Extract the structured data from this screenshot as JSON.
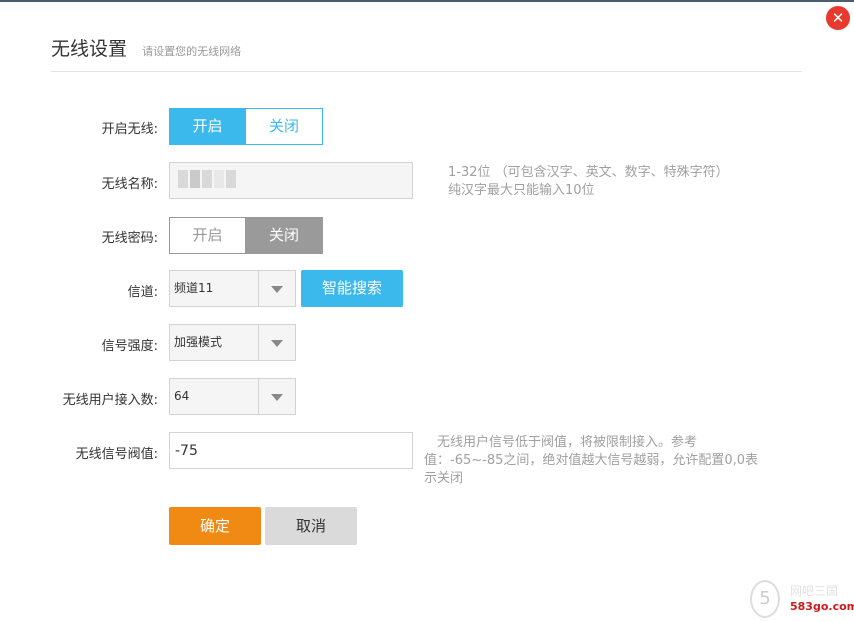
{
  "dialog": {
    "title": "无线设置",
    "subtitle": "请设置您的无线网络",
    "close_symbol": "✕"
  },
  "wireless_switch": {
    "label": "开启无线:",
    "on_label": "开启",
    "off_label": "关闭",
    "selected": "开启"
  },
  "ssid": {
    "label": "无线名称:",
    "value": "",
    "hint_line1": "1-32位 （可包含汉字、英文、数字、特殊字符）",
    "hint_line2": "纯汉字最大只能输入10位"
  },
  "password_switch": {
    "label": "无线密码:",
    "on_label": "开启",
    "off_label": "关闭",
    "selected": "关闭"
  },
  "channel": {
    "label": "信道:",
    "value": "频道11",
    "search_button": "智能搜索"
  },
  "signal_strength": {
    "label": "信号强度:",
    "value": "加强模式"
  },
  "max_clients": {
    "label": "无线用户接入数:",
    "value": "64"
  },
  "signal_threshold": {
    "label": "无线信号阀值:",
    "value": "-75",
    "hint_line1": "无线用户信号低于阀值，将被限制接入。参考",
    "hint_line2": "值：-65~-85之间，绝对值越大信号越弱，允许配置0,0表",
    "hint_line3": "示关闭"
  },
  "actions": {
    "confirm": "确定",
    "cancel": "取消"
  },
  "watermark": {
    "glyph": "5",
    "line1": "网吧三国",
    "line2": "583go.com"
  },
  "colors": {
    "accent": "#3cb9ec",
    "confirm": "#f08a13",
    "close": "#e8392f"
  },
  "icons": [
    "close-icon",
    "dropdown-arrow-icon"
  ]
}
